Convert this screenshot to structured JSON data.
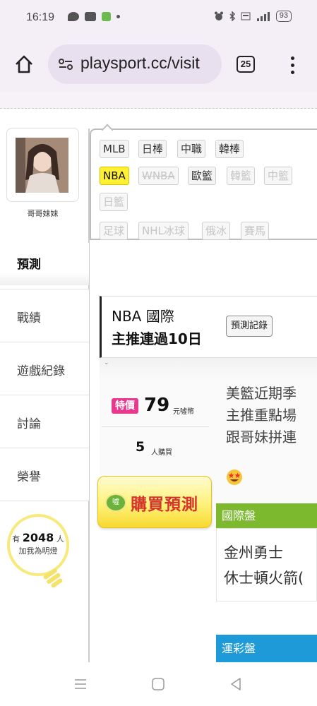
{
  "status_bar": {
    "time": "16:19",
    "battery": "93"
  },
  "browser": {
    "url": "playsport.cc/visit",
    "tab_count": "25"
  },
  "profile": {
    "name": "哥哥妹妹"
  },
  "nav": {
    "active": "預測",
    "items": [
      {
        "label": "戰績"
      },
      {
        "label": "遊戲紀錄"
      },
      {
        "label": "討論"
      },
      {
        "label": "榮譽"
      }
    ]
  },
  "fans": {
    "prefix": "有",
    "count": "2048",
    "suffix": "人",
    "caption": "加我為明燈"
  },
  "filters": {
    "row1": [
      "MLB",
      "日棒",
      "中職",
      "韓棒"
    ],
    "row2": [
      "NBA",
      "WNBA",
      "歐籃",
      "韓籃",
      "中籃"
    ],
    "row3": [
      "日籃"
    ],
    "row4": [
      "足球",
      "NHL冰球",
      "俄冰",
      "賽馬"
    ]
  },
  "panel": {
    "title_line1": "NBA 國際",
    "title_line2": "主推連過10日",
    "record_button": "預測記錄",
    "price_badge": "特價",
    "price": "79",
    "price_unit": "元噓幣",
    "buyers": "5",
    "buyers_unit": "人購買",
    "buy_button": "購買預測",
    "buy_icon_text": "噓",
    "description": [
      "美籃近期季",
      "主推重點場",
      "跟哥妹拼連"
    ],
    "intl_label": "國際盤",
    "team_away": "金州勇士",
    "team_home": "休士頓火箭(",
    "lottery_label": "運彩盤"
  }
}
